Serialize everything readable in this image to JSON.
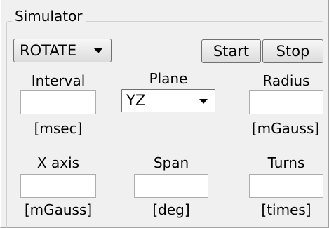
{
  "group": {
    "title": "Simulator"
  },
  "mode_select": {
    "value": "ROTATE"
  },
  "buttons": {
    "start": "Start",
    "stop": "Stop"
  },
  "plane": {
    "label": "Plane",
    "value": "YZ"
  },
  "fields": {
    "interval": {
      "label": "Interval",
      "unit": "[msec]",
      "value": ""
    },
    "radius": {
      "label": "Radius",
      "unit": "[mGauss]",
      "value": ""
    },
    "x_axis": {
      "label": "X axis",
      "unit": "[mGauss]",
      "value": ""
    },
    "span": {
      "label": "Span",
      "unit": "[deg]",
      "value": ""
    },
    "turns": {
      "label": "Turns",
      "unit": "[times]",
      "value": ""
    }
  }
}
